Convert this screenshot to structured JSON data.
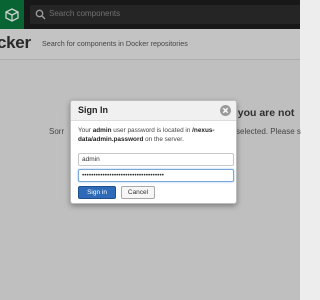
{
  "topbar": {
    "search_placeholder": "Search components"
  },
  "header": {
    "title": "cker",
    "description": "Search for components in Docker repositories"
  },
  "background": {
    "heading": "s you are not",
    "text_left": "Sorr",
    "text_right": "selected. Please s"
  },
  "dialog": {
    "title": "Sign In",
    "message_prefix": "Your ",
    "message_user": "admin",
    "message_mid": " user password is located in ",
    "message_path": "/nexus-data/admin.password",
    "message_suffix": " on the server.",
    "username_value": "admin",
    "password_value": "••••••••••••••••••••••••••••••••••••",
    "signin_label": "Sign in",
    "cancel_label": "Cancel"
  },
  "colors": {
    "topbar": "#1e1e1e",
    "logo": "#0a7b3e",
    "primary_button": "#2e6ab7"
  },
  "icons": [
    "nexus-logo-icon",
    "search-icon",
    "close-icon"
  ]
}
